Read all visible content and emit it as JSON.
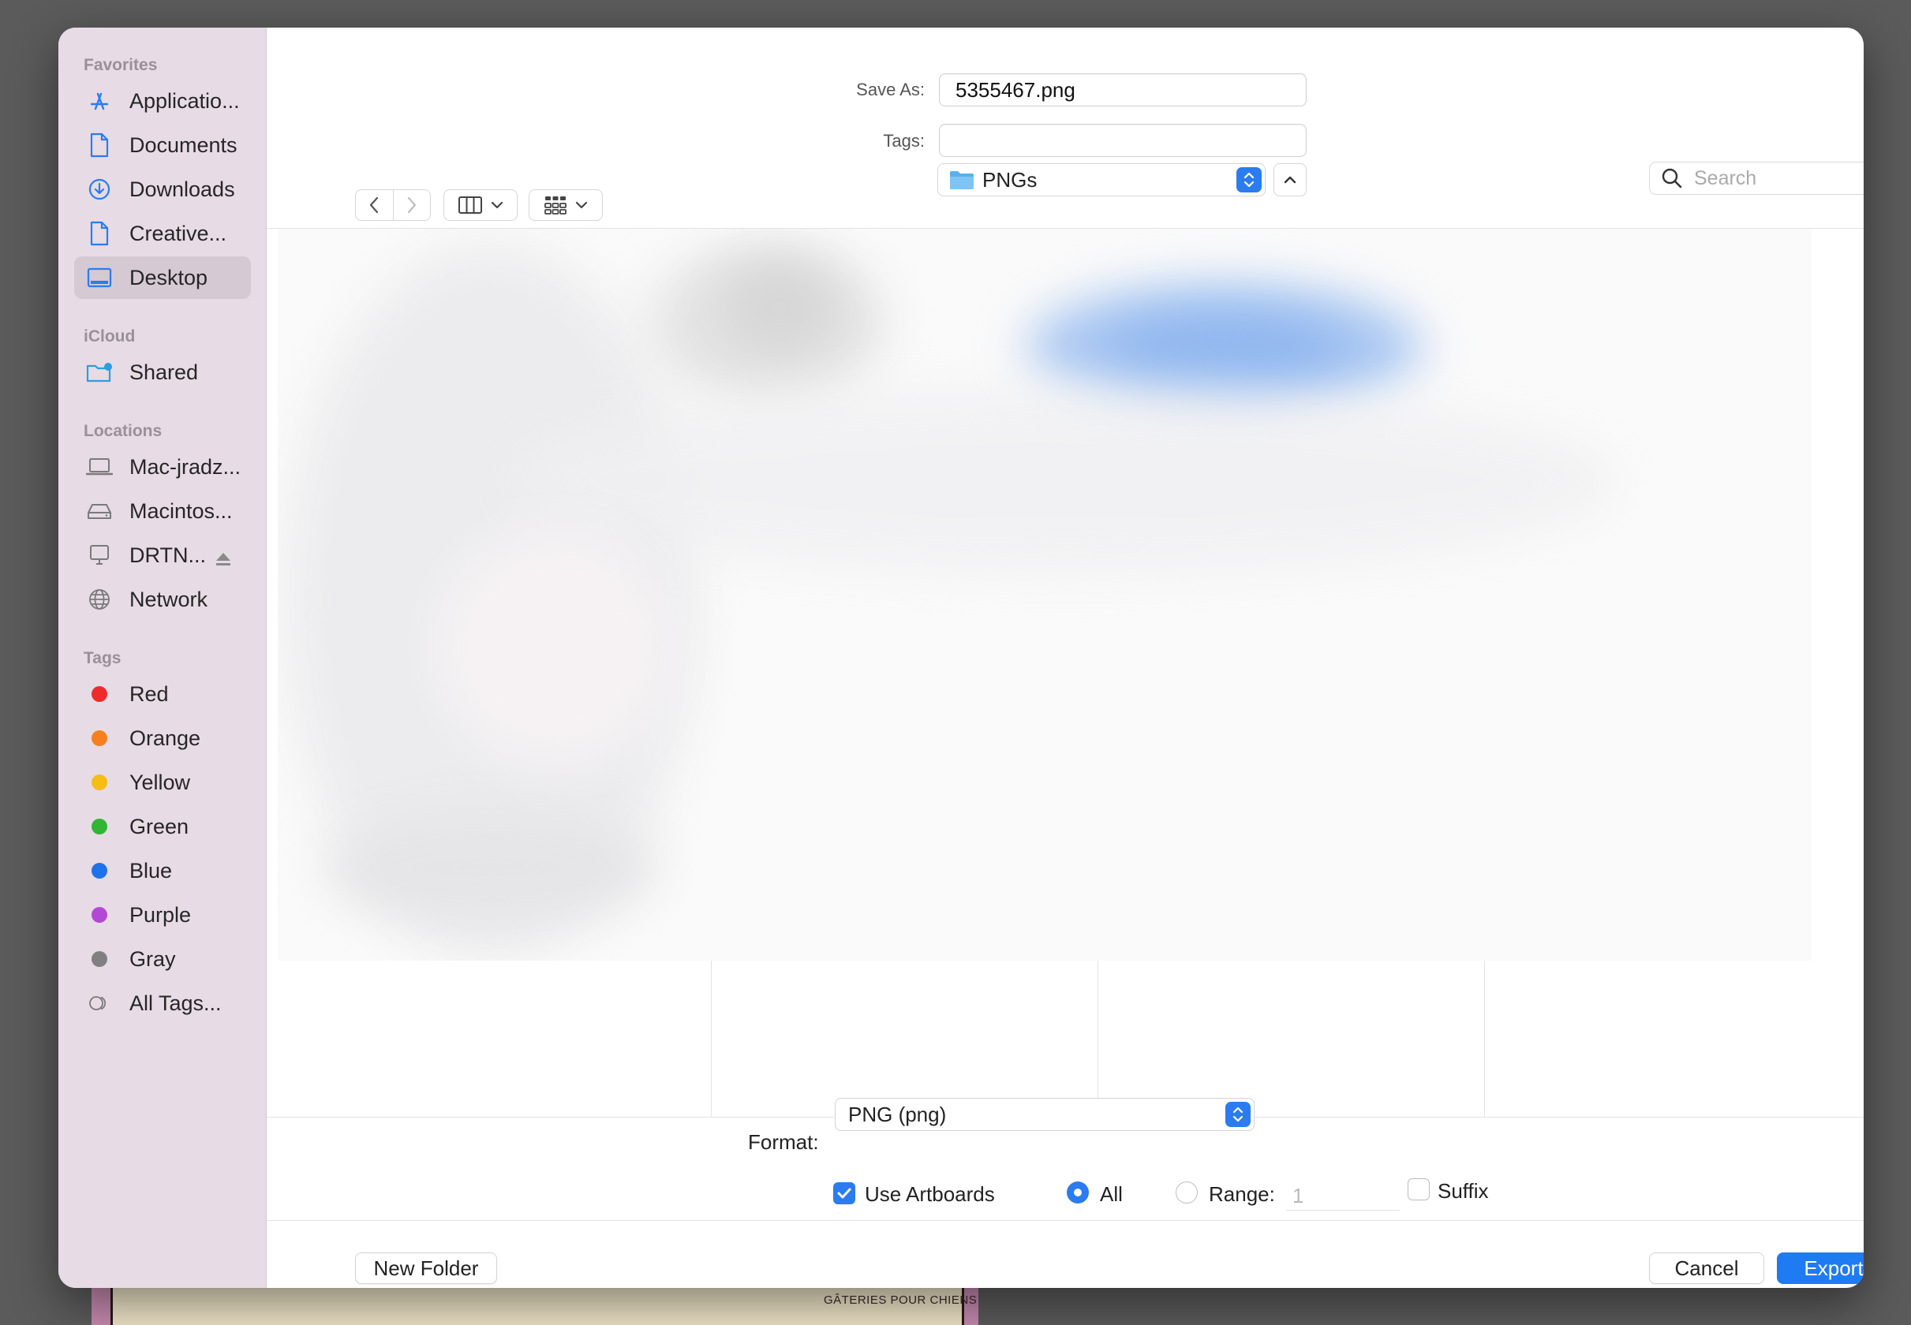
{
  "sidebar": {
    "favorites_header": "Favorites",
    "favorites": [
      {
        "label": "Applicatio...",
        "icon": "applications-icon"
      },
      {
        "label": "Documents",
        "icon": "document-icon"
      },
      {
        "label": "Downloads",
        "icon": "downloads-icon"
      },
      {
        "label": "Creative...",
        "icon": "document-icon"
      },
      {
        "label": "Desktop",
        "icon": "desktop-icon",
        "selected": true
      }
    ],
    "icloud_header": "iCloud",
    "icloud": [
      {
        "label": "Shared",
        "icon": "shared-folder-icon"
      }
    ],
    "locations_header": "Locations",
    "locations": [
      {
        "label": "Mac-jradz...",
        "icon": "laptop-icon"
      },
      {
        "label": "Macintos...",
        "icon": "hard-drive-icon"
      },
      {
        "label": "DRTN...",
        "icon": "display-icon",
        "ejectable": true
      },
      {
        "label": "Network",
        "icon": "globe-icon"
      }
    ],
    "tags_header": "Tags",
    "tags": [
      {
        "label": "Red",
        "color": "#ee2b2b"
      },
      {
        "label": "Orange",
        "color": "#f6801e"
      },
      {
        "label": "Yellow",
        "color": "#f6bd14"
      },
      {
        "label": "Green",
        "color": "#30b535"
      },
      {
        "label": "Blue",
        "color": "#1f72ea"
      },
      {
        "label": "Purple",
        "color": "#b448d6"
      },
      {
        "label": "Gray",
        "color": "#808080"
      },
      {
        "label": "All Tags...",
        "icon": "tags-icon"
      }
    ]
  },
  "header": {
    "save_as_label": "Save As:",
    "save_as_value": "5355467.png",
    "tags_label": "Tags:",
    "tags_value": ""
  },
  "toolbar": {
    "location": "PNGs",
    "search_placeholder": "Search"
  },
  "options": {
    "format_label": "Format:",
    "format_value": "PNG (png)",
    "use_artboards_label": "Use Artboards",
    "use_artboards_checked": true,
    "all_label": "All",
    "range_label": "Range:",
    "range_value": "1",
    "suffix_label": "Suffix",
    "suffix_checked": false
  },
  "footer": {
    "new_folder": "New Folder",
    "cancel": "Cancel",
    "export": "Export"
  },
  "background": {
    "poster_text": "GÂTERIES POUR CHIENS"
  },
  "colors": {
    "accent": "#1f7bf2",
    "sidebar_bg": "#e7dbe6"
  }
}
